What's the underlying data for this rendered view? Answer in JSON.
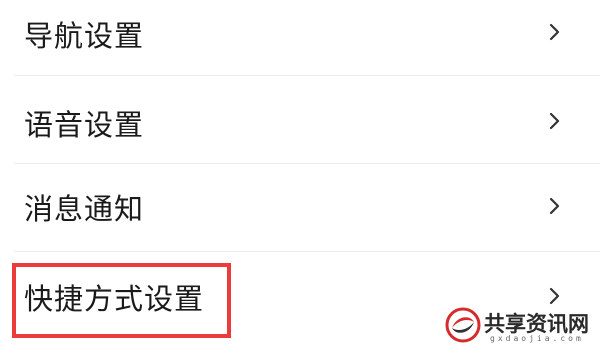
{
  "menu": {
    "items": [
      {
        "label": "导航设置"
      },
      {
        "label": "语音设置"
      },
      {
        "label": "消息通知"
      },
      {
        "label": "快捷方式设置"
      }
    ]
  },
  "highlight": {
    "color": "#ec3b3b"
  },
  "watermark": {
    "name": "共享资讯网",
    "domain": "gxdaojia.com"
  }
}
